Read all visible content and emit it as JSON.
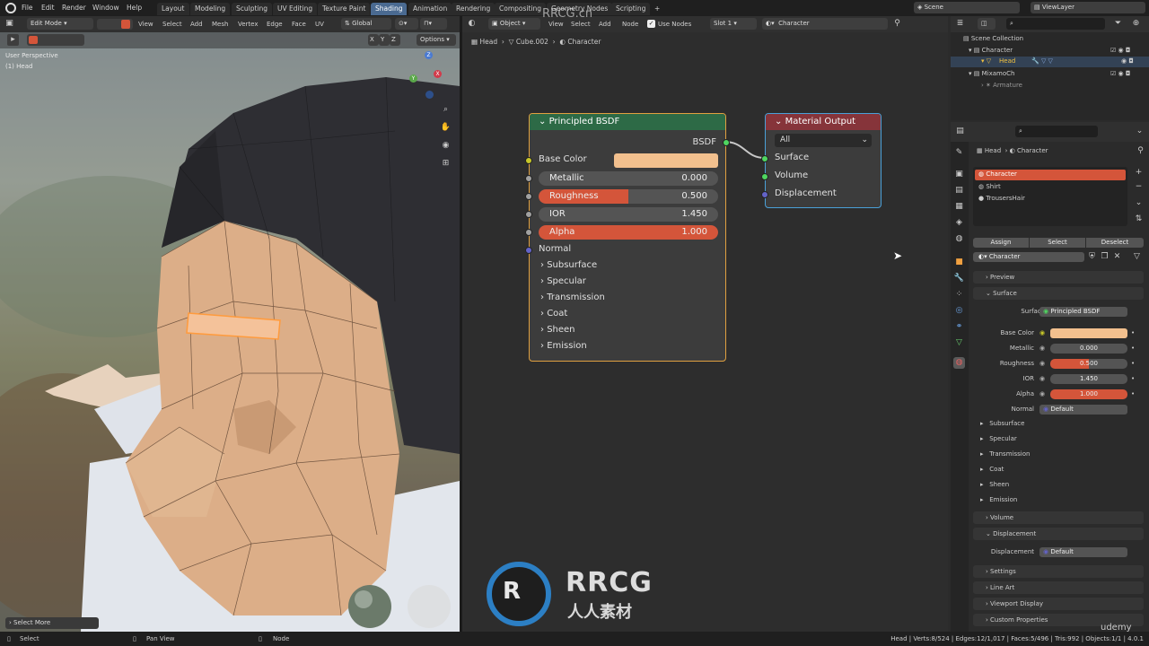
{
  "menubar": {
    "items": [
      "File",
      "Edit",
      "Render",
      "Window",
      "Help"
    ],
    "workspaces": [
      "Layout",
      "Modeling",
      "Sculpting",
      "UV Editing",
      "Texture Paint",
      "Shading",
      "Animation",
      "Rendering",
      "Compositing",
      "Geometry Nodes",
      "Scripting",
      "+"
    ],
    "active_workspace": "Shading",
    "scene": "Scene",
    "view_layer": "ViewLayer"
  },
  "viewport_header": {
    "mode": "Edit Mode",
    "menus": [
      "View",
      "Select",
      "Add",
      "Mesh",
      "Vertex",
      "Edge",
      "Face",
      "UV"
    ],
    "orientation": "Global",
    "axes": [
      "X",
      "Y",
      "Z"
    ],
    "options": "Options"
  },
  "viewport": {
    "perspective": "User Perspective",
    "object": "(1) Head",
    "select_more": "Select More",
    "gizmo": {
      "x": "X",
      "y": "Y",
      "z": "Z"
    }
  },
  "node_header": {
    "type": "Object",
    "menus": [
      "View",
      "Select",
      "Add",
      "Node"
    ],
    "use_nodes": "Use Nodes",
    "slot": "Slot 1",
    "material": "Character"
  },
  "breadcrumb": {
    "object": "Head",
    "mesh": "Cube.002",
    "material": "Character"
  },
  "bsdf_node": {
    "title": "Principled BSDF",
    "output": "BSDF",
    "base_color_label": "Base Color",
    "base_color": "#f2c08e",
    "metallic_label": "Metallic",
    "metallic": "0.000",
    "roughness_label": "Roughness",
    "roughness": "0.500",
    "roughness_fill": 0.5,
    "ior_label": "IOR",
    "ior": "1.450",
    "alpha_label": "Alpha",
    "alpha": "1.000",
    "alpha_fill": 1.0,
    "normal_label": "Normal",
    "panels": [
      "Subsurface",
      "Specular",
      "Transmission",
      "Coat",
      "Sheen",
      "Emission"
    ]
  },
  "output_node": {
    "title": "Material Output",
    "target": "All",
    "inputs": [
      "Surface",
      "Volume",
      "Displacement"
    ]
  },
  "outliner": {
    "title": "Scene Collection",
    "rows": [
      "Character",
      "Head",
      "MixamoCh",
      "Armature"
    ]
  },
  "properties": {
    "breadcrumb_object": "Head",
    "breadcrumb_material": "Character",
    "slots": [
      "Character",
      "Shirt",
      "TrousersHair"
    ],
    "assign": "Assign",
    "select": "Select",
    "deselect": "Deselect",
    "material": "Character",
    "preview": "Preview",
    "surface_section": "Surface",
    "surface_label": "Surface",
    "surface_value": "Principled BSDF",
    "base_color_label": "Base Color",
    "metallic_label": "Metallic",
    "metallic": "0.000",
    "roughness_label": "Roughness",
    "roughness": "0.500",
    "ior_label": "IOR",
    "ior": "1.450",
    "alpha_label": "Alpha",
    "alpha": "1.000",
    "normal_label": "Normal",
    "normal_value": "Default",
    "sub_panels": [
      "Subsurface",
      "Specular",
      "Transmission",
      "Coat",
      "Sheen",
      "Emission"
    ],
    "volume": "Volume",
    "displacement_section": "Displacement",
    "displacement_label": "Displacement",
    "displacement_value": "Default",
    "settings": "Settings",
    "line_art": "Line Art",
    "viewport_display": "Viewport Display",
    "custom_properties": "Custom Properties"
  },
  "statusbar": {
    "select": "Select",
    "pan": "Pan View",
    "node": "Node",
    "stats": "Head | Verts:8/524 | Edges:12/1,017 | Faces:5/496 | Tris:992 | Objects:1/1 | 4.0.1"
  },
  "watermark": {
    "brand": "RRCG",
    "sub": "人人素材",
    "site": "RRCG.cn",
    "udemy": "udemy"
  },
  "colors": {
    "accent": "#4a6a91",
    "active_red": "#d4553a",
    "bsdf_header": "#2d6a46",
    "output_header": "#86343a",
    "skin": "#dcae88",
    "hair": "#2e2e33"
  }
}
